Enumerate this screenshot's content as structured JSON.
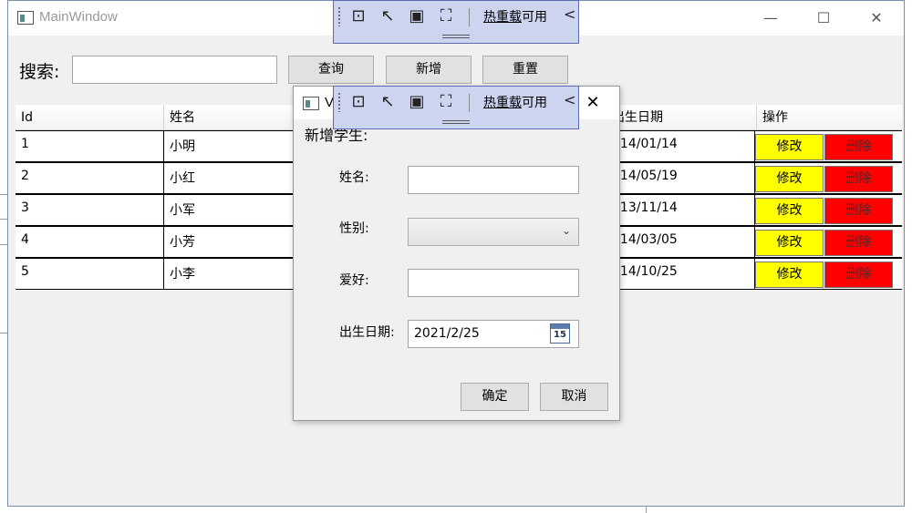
{
  "main_window": {
    "title": "MainWindow",
    "controls": {
      "minimize": "—",
      "maximize": "☐",
      "close": "✕"
    }
  },
  "search": {
    "label": "搜索:",
    "value": "",
    "query_button": "查询",
    "add_button": "新增",
    "reset_button": "重置"
  },
  "grid": {
    "headers": [
      "Id",
      "姓名",
      "出生日期",
      "操作"
    ],
    "rows": [
      {
        "id": "1",
        "name": "小明",
        "birth": "014/01/14"
      },
      {
        "id": "2",
        "name": "小红",
        "birth": "014/05/19"
      },
      {
        "id": "3",
        "name": "小军",
        "birth": "013/11/14"
      },
      {
        "id": "4",
        "name": "小芳",
        "birth": "014/03/05"
      },
      {
        "id": "5",
        "name": "小李",
        "birth": "014/10/25"
      }
    ],
    "edit_label": "修改",
    "delete_label": "删除"
  },
  "dialog": {
    "title": "V",
    "heading": "新增学生:",
    "name_label": "姓名:",
    "name_value": "",
    "gender_label": "性别:",
    "gender_value": "",
    "hobby_label": "爱好:",
    "hobby_value": "",
    "birth_label": "出生日期:",
    "birth_value": "2021/2/25",
    "calendar_day": "15",
    "ok_button": "确定",
    "cancel_button": "取消",
    "close_glyph": "✕"
  },
  "hot_reload": {
    "label_underlined": "热重载",
    "label_rest": "可用",
    "collapse_glyph": "<"
  },
  "colors": {
    "edit_button": "#ffff00",
    "delete_button": "#ff0000",
    "toolbar_bg": "#ccd4f0"
  }
}
